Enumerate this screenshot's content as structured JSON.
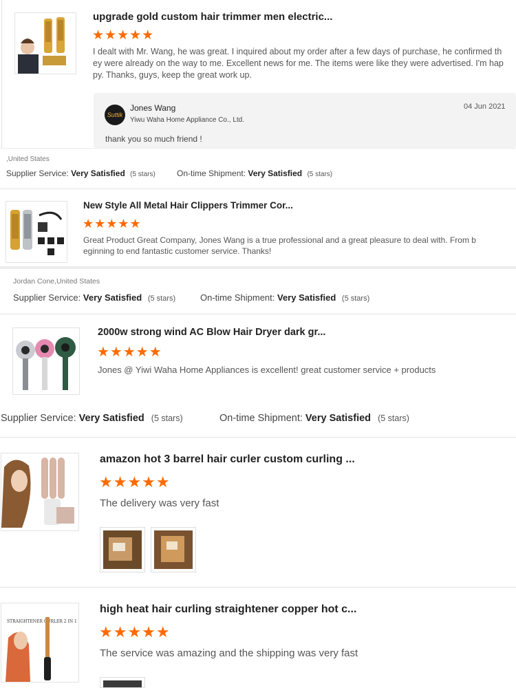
{
  "accent_color": "#ff6a00",
  "reviews": [
    {
      "product_title": "upgrade gold custom hair trimmer men electric...",
      "stars": "★★★★★",
      "text_line1": "I dealt with Mr. Wang, he was great. I inquired about my order after a few days of purchase, he confirmed th",
      "text_line2": "ey were already on the way to me. Excellent news for me. The items were like they were advertised. I'm hap",
      "text_line3": "py. Thanks, guys, keep the great work up.",
      "reply": {
        "avatar_text": "Suttik",
        "name": "Jones Wang",
        "company": "Yiwu Waha Home Appliance Co., Ltd.",
        "date": "04 Jun 2021",
        "message": "thank you so much friend !"
      },
      "location": ",United States",
      "supplier_label": "Supplier Service:",
      "supplier_value": "Very Satisfied",
      "supplier_count": "(5 stars)",
      "shipment_label": "On-time Shipment:",
      "shipment_value": "Very Satisfied",
      "shipment_count": "(5 stars)"
    },
    {
      "product_title": "New Style All Metal Hair Clippers Trimmer Cor...",
      "stars": "★★★★★",
      "text_line1": "Great Product Great Company, Jones Wang is a true professional and a great pleasure to deal with. From b",
      "text_line2": "eginning to end fantastic customer service. Thanks!",
      "location": "Jordan Cone,United States",
      "supplier_label": "Supplier Service:",
      "supplier_value": "Very Satisfied",
      "supplier_count": "(5 stars)",
      "shipment_label": "On-time Shipment:",
      "shipment_value": "Very Satisfied",
      "shipment_count": "(5 stars)"
    },
    {
      "product_title": "2000w strong wind AC Blow Hair Dryer dark gr...",
      "stars": "★★★★★",
      "text_line1": "Jones @ Yiwi Waha Home Appliances is excellent! great customer service + products",
      "supplier_label": "Supplier Service:",
      "supplier_value": "Very Satisfied",
      "supplier_count": "(5 stars)",
      "shipment_label": "On-time Shipment:",
      "shipment_value": "Very Satisfied",
      "shipment_count": "(5 stars)"
    },
    {
      "product_title": "amazon hot 3 barrel hair curler custom curling ...",
      "stars": "★★★★★",
      "text_line1": "The delivery was very fast"
    },
    {
      "product_title": "high heat hair curling straightener copper hot c...",
      "stars": "★★★★★",
      "text_line1": "The service was amazing and the shipping was very fast",
      "thumb_caption": "STRAIGHTENER CURLER 2 IN 1"
    }
  ]
}
